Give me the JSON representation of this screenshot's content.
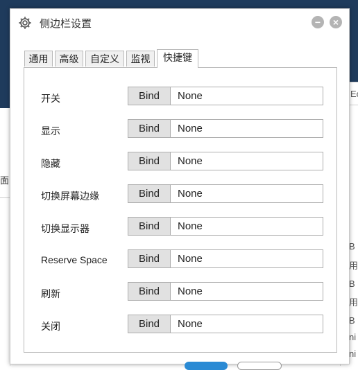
{
  "background": {
    "right_box_text": "Ec",
    "left_text": "面",
    "right_fragments": [
      "B",
      "用",
      "B",
      "用",
      "B",
      "ni",
      "ni"
    ]
  },
  "dialog": {
    "title": "侧边栏设置",
    "tabs": [
      {
        "label": "通用"
      },
      {
        "label": "高级"
      },
      {
        "label": "自定义"
      },
      {
        "label": "监视"
      },
      {
        "label": "快捷键"
      }
    ],
    "active_tab": "快捷键",
    "bind_label": "Bind",
    "rows": [
      {
        "label": "开关",
        "value": "None"
      },
      {
        "label": "显示",
        "value": "None"
      },
      {
        "label": "隐藏",
        "value": "None"
      },
      {
        "label": "切换屏幕边缘",
        "value": "None"
      },
      {
        "label": "切换显示器",
        "value": "None"
      },
      {
        "label": "Reserve Space",
        "value": "None"
      },
      {
        "label": "刷新",
        "value": "None"
      },
      {
        "label": "关闭",
        "value": "None"
      }
    ]
  },
  "colors": {
    "background_header": "#1f3b5c",
    "window_button": "#b4b4b4",
    "accent_blue": "#2a8ad4"
  }
}
